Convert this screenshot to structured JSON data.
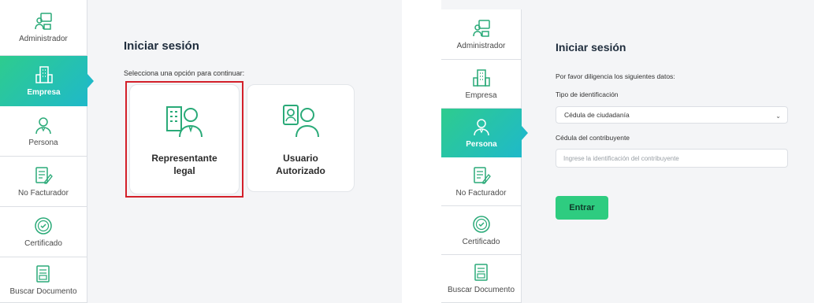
{
  "colors": {
    "accent_green": "#2ecc80",
    "accent_teal": "#1fb9c9",
    "highlight_red": "#d3202a",
    "icon_green": "#2aaa78"
  },
  "left": {
    "sidebar": {
      "items": [
        {
          "label": "Administrador",
          "icon": "admin-icon"
        },
        {
          "label": "Empresa",
          "icon": "building-icon",
          "active": true
        },
        {
          "label": "Persona",
          "icon": "person-icon"
        },
        {
          "label": "No Facturador",
          "icon": "document-edit-icon"
        },
        {
          "label": "Certificado",
          "icon": "certificate-icon"
        },
        {
          "label": "Buscar Documento",
          "icon": "search-document-icon"
        }
      ]
    },
    "main": {
      "title": "Iniciar sesión",
      "subtitle": "Selecciona una opción para continuar:",
      "cards": [
        {
          "line1": "Representante",
          "line2": "legal",
          "icon": "legal-representative-icon"
        },
        {
          "line1": "Usuario",
          "line2": "Autorizado",
          "icon": "authorized-user-icon"
        }
      ]
    }
  },
  "right": {
    "sidebar": {
      "items": [
        {
          "label": "Administrador",
          "icon": "admin-icon"
        },
        {
          "label": "Empresa",
          "icon": "building-icon"
        },
        {
          "label": "Persona",
          "icon": "person-icon",
          "active": true
        },
        {
          "label": "No Facturador",
          "icon": "document-edit-icon"
        },
        {
          "label": "Certificado",
          "icon": "certificate-icon"
        },
        {
          "label": "Buscar Documento",
          "icon": "search-document-icon"
        }
      ]
    },
    "form": {
      "title": "Iniciar sesión",
      "instructions": "Por favor diligencia los siguientes datos:",
      "id_type_label": "Tipo de identificación",
      "id_type_value": "Cédula de ciudadanía",
      "taxpayer_label": "Cédula del contribuyente",
      "taxpayer_placeholder": "Ingrese la identificación del contribuyente",
      "submit_label": "Entrar"
    }
  }
}
